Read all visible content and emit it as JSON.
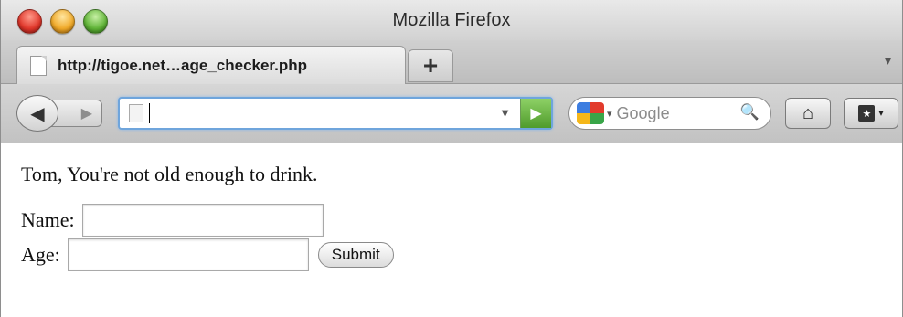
{
  "window": {
    "title": "Mozilla Firefox"
  },
  "tabs": {
    "active_tab_label": "http://tigoe.net…age_checker.php",
    "new_tab_label": "+",
    "list_arrow": "▾"
  },
  "navbar": {
    "back_icon": "◀",
    "forward_icon": "▶",
    "url_value": "",
    "url_dropdown_icon": "▼",
    "go_icon": "▶",
    "search_engine_caret": "▾",
    "search_placeholder": "Google",
    "search_icon": "🔍",
    "home_icon": "⌂",
    "bookmark_icon": "★",
    "bookmark_caret": "▾"
  },
  "content": {
    "message": "Tom, You're not old enough to drink.",
    "form": {
      "name_label": "Name:",
      "name_value": "",
      "age_label": "Age:",
      "age_value": "",
      "submit_label": "Submit"
    }
  },
  "colors": {
    "url_focus_border": "#6fa5dc",
    "go_button": "#4f9b2c"
  }
}
